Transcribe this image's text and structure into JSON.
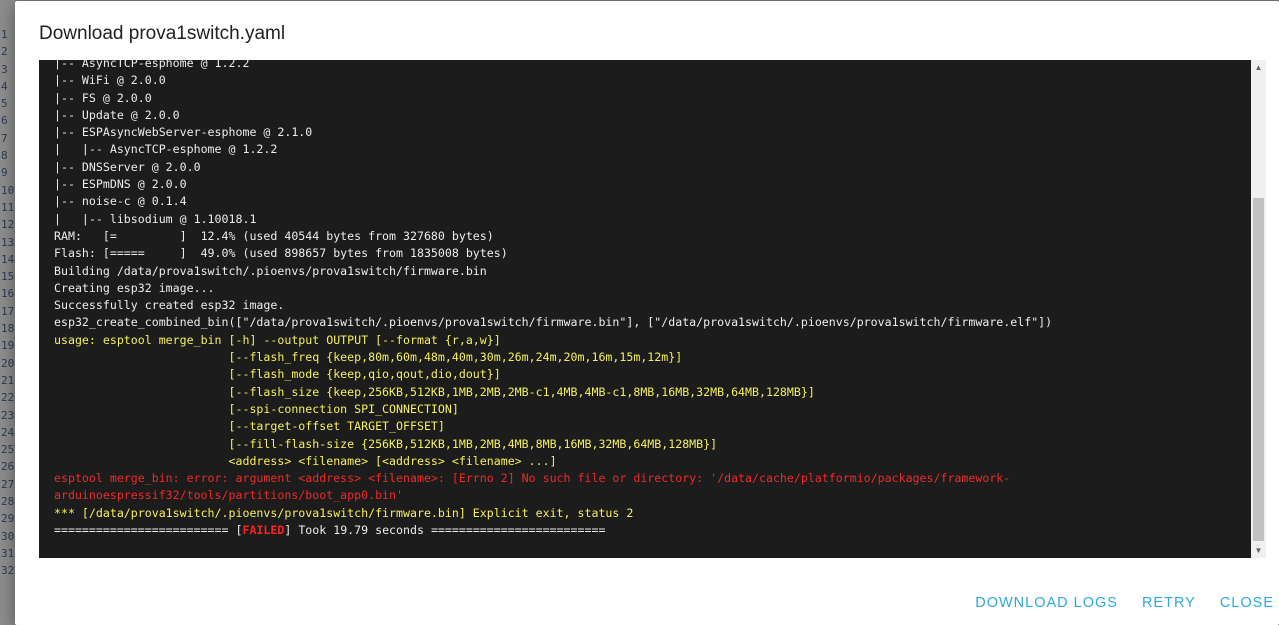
{
  "background_line_numbers": [
    "1",
    "2",
    "3",
    "4",
    "5",
    "6",
    "7",
    "8",
    "9",
    "10",
    "11",
    "12",
    "13",
    "14",
    "15",
    "16",
    "17",
    "18",
    "19",
    "20",
    "21",
    "22",
    "23",
    "24",
    "25",
    "26",
    "27",
    "28",
    "29",
    "30",
    "31",
    "32"
  ],
  "dialog": {
    "title": "Download prova1switch.yaml",
    "log_lines": [
      {
        "text": "|-- AsyncTCP-esphome @ 1.2.2",
        "color": "default"
      },
      {
        "text": "|-- WiFi @ 2.0.0",
        "color": "default"
      },
      {
        "text": "|-- FS @ 2.0.0",
        "color": "default"
      },
      {
        "text": "|-- Update @ 2.0.0",
        "color": "default"
      },
      {
        "text": "|-- ESPAsyncWebServer-esphome @ 2.1.0",
        "color": "default"
      },
      {
        "text": "|   |-- AsyncTCP-esphome @ 1.2.2",
        "color": "default"
      },
      {
        "text": "|-- DNSServer @ 2.0.0",
        "color": "default"
      },
      {
        "text": "|-- ESPmDNS @ 2.0.0",
        "color": "default"
      },
      {
        "text": "|-- noise-c @ 0.1.4",
        "color": "default"
      },
      {
        "text": "|   |-- libsodium @ 1.10018.1",
        "color": "default"
      },
      {
        "text": "RAM:   [=         ]  12.4% (used 40544 bytes from 327680 bytes)",
        "color": "default"
      },
      {
        "text": "Flash: [=====     ]  49.0% (used 898657 bytes from 1835008 bytes)",
        "color": "default"
      },
      {
        "text": "Building /data/prova1switch/.pioenvs/prova1switch/firmware.bin",
        "color": "default"
      },
      {
        "text": "Creating esp32 image...",
        "color": "default"
      },
      {
        "text": "Successfully created esp32 image.",
        "color": "default"
      },
      {
        "text": "esp32_create_combined_bin([\"/data/prova1switch/.pioenvs/prova1switch/firmware.bin\"], [\"/data/prova1switch/.pioenvs/prova1switch/firmware.elf\"])",
        "color": "default"
      },
      {
        "text": "usage: esptool merge_bin [-h] --output OUTPUT [--format {r,a,w}]",
        "color": "yellow"
      },
      {
        "text": "                         [--flash_freq {keep,80m,60m,48m,40m,30m,26m,24m,20m,16m,15m,12m}]",
        "color": "yellow"
      },
      {
        "text": "                         [--flash_mode {keep,qio,qout,dio,dout}]",
        "color": "yellow"
      },
      {
        "text": "                         [--flash_size {keep,256KB,512KB,1MB,2MB,2MB-c1,4MB,4MB-c1,8MB,16MB,32MB,64MB,128MB}]",
        "color": "yellow"
      },
      {
        "text": "                         [--spi-connection SPI_CONNECTION]",
        "color": "yellow"
      },
      {
        "text": "                         [--target-offset TARGET_OFFSET]",
        "color": "yellow"
      },
      {
        "text": "                         [--fill-flash-size {256KB,512KB,1MB,2MB,4MB,8MB,16MB,32MB,64MB,128MB}]",
        "color": "yellow"
      },
      {
        "text": "                         <address> <filename> [<address> <filename> ...]",
        "color": "yellow"
      },
      {
        "text": "esptool merge_bin: error: argument <address> <filename>: [Errno 2] No such file or directory: '/data/cache/platformio/packages/framework-",
        "color": "red"
      },
      {
        "text": "arduinoespressif32/tools/partitions/boot_app0.bin'",
        "color": "red"
      },
      {
        "text": "*** [/data/prova1switch/.pioenvs/prova1switch/firmware.bin] Explicit exit, status 2",
        "color": "yellow"
      }
    ],
    "final_line": {
      "prefix": "========================= [",
      "status": "FAILED",
      "suffix": "] Took 19.79 seconds ========================="
    },
    "scroll_position_percent": 100,
    "actions": {
      "download_logs": "DOWNLOAD LOGS",
      "retry": "RETRY",
      "close": "CLOSE"
    },
    "colors": {
      "accent": "#2ea8e0",
      "terminal_bg": "#1c1c1c",
      "warning": "#f5f05a",
      "error": "#ee2a2a"
    }
  }
}
